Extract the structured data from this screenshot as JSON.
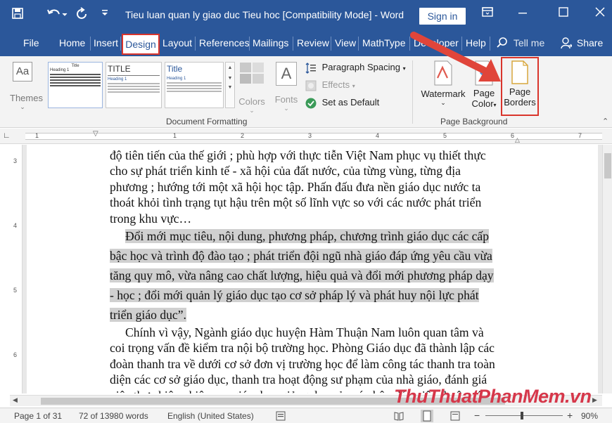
{
  "title_bar": {
    "document_title": "Tieu luan quan ly giao duc Tieu hoc [Compatibility Mode]  -  Word",
    "sign_in": "Sign in",
    "icons": [
      "save-icon",
      "undo-icon",
      "redo-icon",
      "customize-quick-access-icon",
      "ribbon-display-options-icon",
      "minimize-icon",
      "maximize-icon",
      "close-icon"
    ]
  },
  "tabs": [
    {
      "label": "File"
    },
    {
      "label": "Home"
    },
    {
      "label": "Insert"
    },
    {
      "label": "Design",
      "active": true
    },
    {
      "label": "Layout"
    },
    {
      "label": "References"
    },
    {
      "label": "Mailings"
    },
    {
      "label": "Review"
    },
    {
      "label": "View"
    },
    {
      "label": "MathType"
    },
    {
      "label": "Developer"
    },
    {
      "label": "Help"
    },
    {
      "label": "Tell me"
    },
    {
      "label": "Share"
    }
  ],
  "ribbon": {
    "themes_label": "Themes",
    "gallery": {
      "item1_title": "Title",
      "item1_heading": "Heading 1",
      "item2_title": "TITLE",
      "item2_heading": "Heading 1",
      "item3_title": "Title",
      "item3_heading": "Heading 1"
    },
    "colors_label": "Colors",
    "fonts_label": "Fonts",
    "paragraph_spacing": "Paragraph Spacing",
    "effects": "Effects",
    "set_as_default": "Set as Default",
    "document_formatting_label": "Document Formatting",
    "watermark": "Watermark",
    "page_color_1": "Page",
    "page_color_2": "Color",
    "page_borders_1": "Page",
    "page_borders_2": "Borders",
    "page_background_label": "Page Background"
  },
  "ruler": {
    "numbers": [
      "1",
      "1",
      "2",
      "3",
      "4",
      "5",
      "6",
      "7"
    ]
  },
  "vruler": {
    "numbers": [
      "3",
      "4",
      "5",
      "6"
    ]
  },
  "document": {
    "para1": [
      "độ tiên tiến của thế giới ; phù hợp với thực tiễn Việt Nam phục vụ thiết thực",
      "cho sự phát triển kinh tế - xã hội của đất nước, của từng vùng, từng địa",
      "phương ; hướng tới một xã hội học tập. Phấn đấu đưa nền giáo dục nước ta",
      "thoát khỏi tình trạng tụt hậu trên một số lĩnh vực so với các nước phát triển",
      "trong khu vực…"
    ],
    "para2": [
      "Đổi mới mục tiêu, nội dung, phương pháp, chương trình giáo dục các cấp",
      "bậc học và trình độ đào tạo ; phát triển đội ngũ nhà giáo đáp ứng yêu cầu vừa",
      "tăng quy mô, vừa nâng cao chất lượng, hiệu quả và đổi mới phương pháp dạy",
      "- học ; đổi mới quản lý giáo dục tạo cơ sở pháp lý và phát huy nội lực phát",
      "triển giáo dục”."
    ],
    "para3": [
      "Chính vì vậy, Ngành giáo dục huyện Hàm Thuận Nam luôn quan tâm và",
      "coi trọng vấn đề kiểm tra nội bộ trường học. Phòng Giáo dục đã thành lập các",
      "đoàn thanh tra về dưới cơ sở đơn vị trường học để làm công tác thanh tra toàn",
      "diện các cơ sở giáo dục, thanh tra hoạt động sư phạm của nhà giáo, đánh giá",
      "việc thực hiện nhiệm vụ giáo dục, giảng dạy của cán bộ, giáo viên thuộc các"
    ]
  },
  "status_bar": {
    "page": "Page 1 of 31",
    "words": "72 of 13980 words",
    "language": "English (United States)",
    "zoom": "90%",
    "zoom_minus": "−",
    "zoom_plus": "+"
  },
  "watermark_text": "ThuThuatPhanMem.vn",
  "colors": {
    "accent": "#2b579a",
    "highlight_box": "#d9342b",
    "selection": "#d0d0d0"
  }
}
